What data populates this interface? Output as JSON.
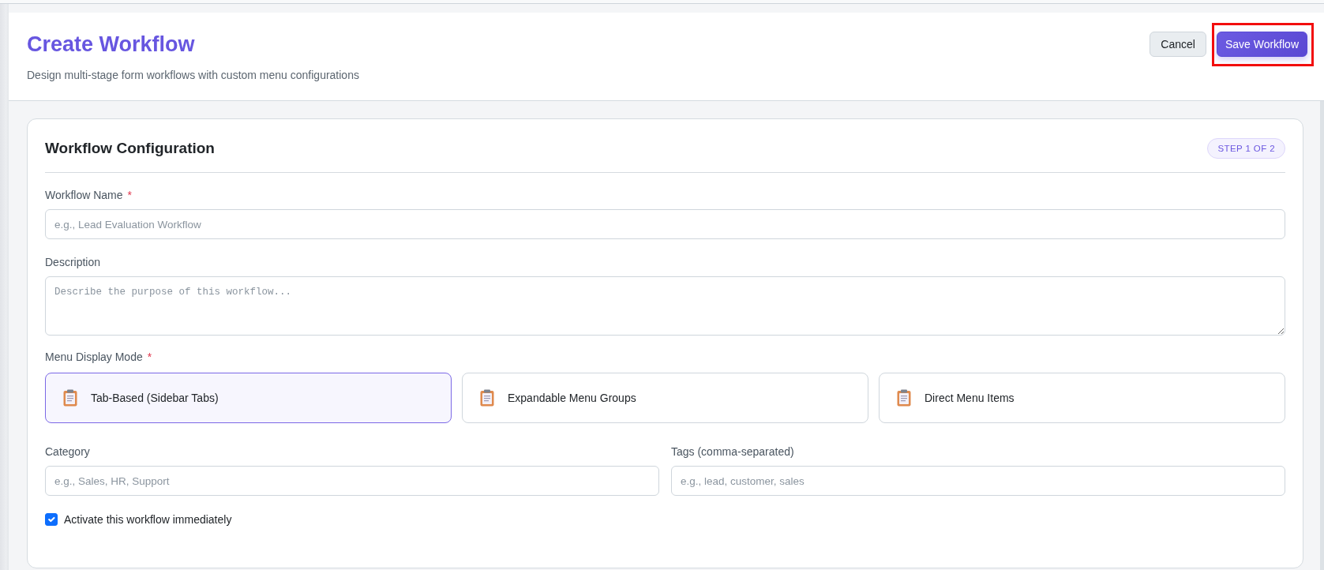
{
  "header": {
    "title": "Create Workflow",
    "subtitle": "Design multi-stage form workflows with custom menu configurations",
    "buttons": [
      {
        "label": "Cancel",
        "kind": "secondary",
        "highlighted": false
      },
      {
        "label": "Save Workflow",
        "kind": "primary",
        "highlighted": true
      }
    ]
  },
  "form_card": {
    "title": "Workflow Configuration",
    "step_badge": "STEP 1 OF 2",
    "workflow_name": {
      "label": "Workflow Name",
      "required_mark": "*",
      "placeholder": "e.g., Lead Evaluation Workflow"
    },
    "description": {
      "label": "Description",
      "placeholder": "Describe the purpose of this workflow..."
    },
    "menu_display_mode": {
      "label": "Menu Display Mode",
      "required_mark": "*",
      "options": [
        {
          "label": "Tab-Based (Sidebar Tabs)",
          "selected": true
        },
        {
          "label": "Expandable Menu Groups",
          "selected": false
        },
        {
          "label": "Direct Menu Items",
          "selected": false
        }
      ]
    },
    "category": {
      "label": "Category",
      "placeholder": "e.g., Sales, HR, Support"
    },
    "tags": {
      "label": "Tags (comma-separated)",
      "placeholder": "e.g., lead, customer, sales"
    },
    "activate": {
      "label": "Activate this workflow immediately",
      "checked": true
    }
  }
}
